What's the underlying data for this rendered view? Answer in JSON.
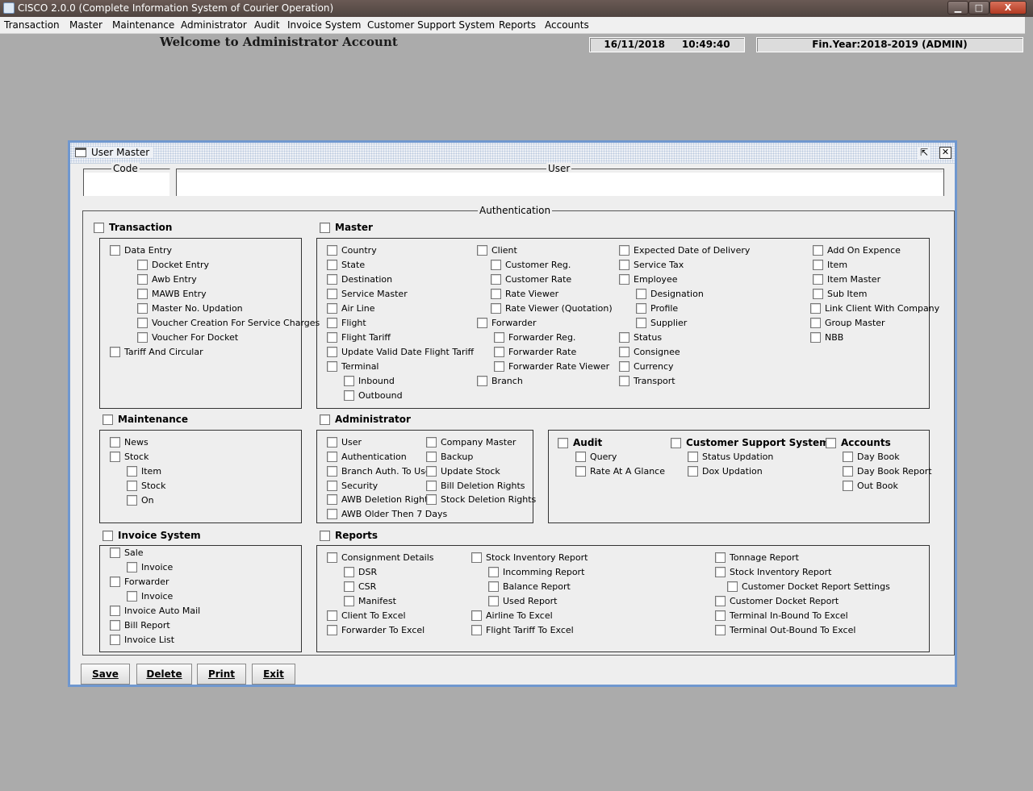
{
  "window": {
    "title": "CISCO 2.0.0 (Complete Information System of Courier Operation)",
    "minimize_glyph": "▁",
    "maximize_glyph": "□",
    "close_glyph": "X"
  },
  "menu": [
    "Transaction",
    "Master",
    "Maintenance",
    "Administrator",
    "Audit",
    "Invoice System",
    "Customer Support System",
    "Reports",
    "Accounts"
  ],
  "header": {
    "welcome": "Welcome to Administrator Account",
    "date": "16/11/2018",
    "time": "10:49:40",
    "fin_year": "Fin.Year:2018-2019  (ADMIN)"
  },
  "frame": {
    "title": "User Master",
    "restore_glyph": "⇱",
    "close_glyph": "✕",
    "code_label": "Code",
    "code_value": "",
    "user_label": "User",
    "user_value": "",
    "auth_label": "Authentication"
  },
  "sections": {
    "transaction": {
      "title": "Transaction",
      "items": [
        "Data Entry",
        "Docket Entry",
        "Awb Entry",
        "MAWB Entry",
        "Master No. Updation",
        "Voucher Creation For Service Charges",
        "Voucher For Docket",
        "Tariff And Circular"
      ]
    },
    "master": {
      "title": "Master",
      "items": [
        "Country",
        "State",
        "Destination",
        "Service Master",
        "Air Line",
        "Flight",
        "Flight Tariff",
        "Update Valid Date Flight Tariff",
        "Terminal",
        "Inbound",
        "Outbound",
        "Client",
        "Customer Reg.",
        "Customer Rate",
        "Rate Viewer",
        "Rate Viewer (Quotation)",
        "Forwarder",
        "Forwarder Reg.",
        "Forwarder Rate",
        "Forwarder Rate Viewer",
        "Branch",
        "Expected Date of Delivery",
        "Service Tax",
        "Employee",
        "Designation",
        "Profile",
        "Supplier",
        "Status",
        "Consignee",
        "Currency",
        "Transport",
        "Add On Expence",
        "Item",
        "Item Master",
        "Sub Item",
        "Link Client With Company",
        "Group Master",
        "NBB"
      ]
    },
    "maintenance": {
      "title": "Maintenance",
      "items": [
        "News",
        "Stock",
        "Item",
        "Stock",
        "On"
      ]
    },
    "administrator": {
      "title": "Administrator",
      "items": [
        "User",
        "Authentication",
        "Branch Auth. To User",
        "Security",
        "AWB Deletion Rights",
        "AWB Older Then 7 Days",
        "Company Master",
        "Backup",
        "Update Stock",
        "Bill Deletion Rights",
        "Stock Deletion Rights"
      ]
    },
    "audit": {
      "title": "Audit",
      "items": [
        "Query",
        "Rate At A Glance"
      ]
    },
    "support": {
      "title": "Customer Support System",
      "items": [
        "Status Updation",
        "Dox Updation"
      ]
    },
    "accounts": {
      "title": "Accounts",
      "items": [
        "Day Book",
        "Day Book Report",
        "Out Book"
      ]
    },
    "invoice": {
      "title": "Invoice System",
      "items": [
        "Sale",
        "Invoice",
        "Forwarder",
        "Invoice",
        "Invoice Auto Mail",
        "Bill Report",
        "Invoice List"
      ]
    },
    "reports": {
      "title": "Reports",
      "items": [
        "Consignment Details",
        "DSR",
        "CSR",
        "Manifest",
        "Client To Excel",
        "Forwarder To Excel",
        "Stock Inventory Report",
        "Incomming Report",
        "Balance Report",
        "Used Report",
        "Airline To Excel",
        "Flight Tariff To Excel",
        "Tonnage Report",
        "Stock Inventory Report",
        "Customer Docket Report Settings",
        "Customer Docket Report",
        "Terminal In-Bound To Excel",
        "Terminal Out-Bound To Excel"
      ]
    }
  },
  "buttons": {
    "save": "Save",
    "delete": "Delete",
    "print": "Print",
    "exit": "Exit"
  }
}
